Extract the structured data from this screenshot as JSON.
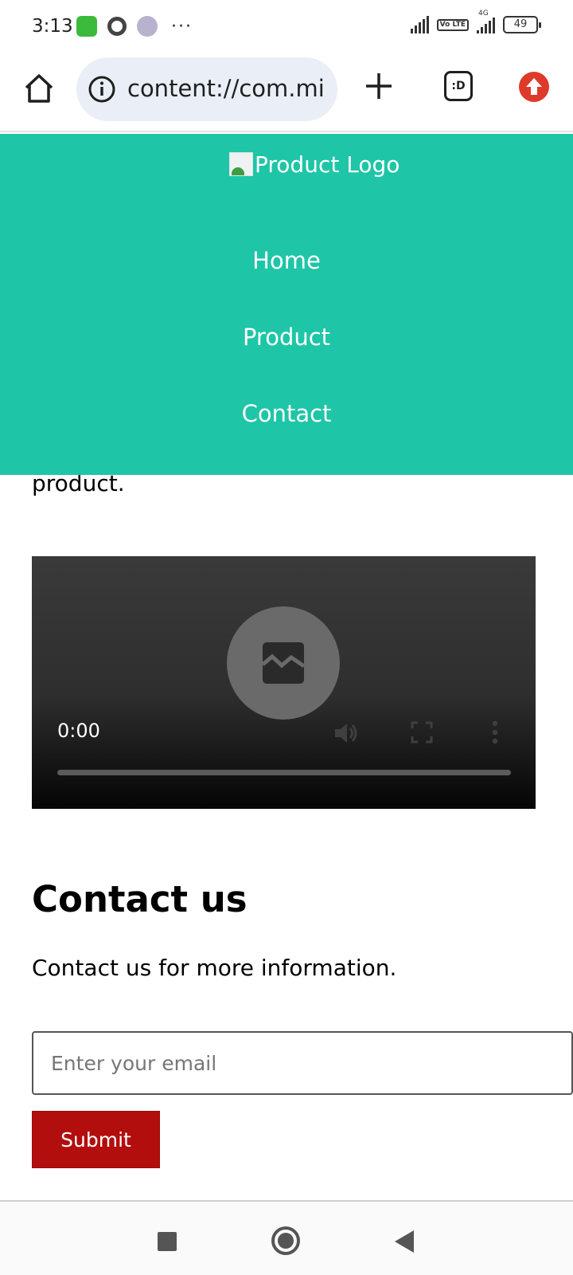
{
  "status_bar": {
    "time": "3:13",
    "network_label": "4G",
    "volte_label": "Vo LTE",
    "battery": "49",
    "overflow": "···"
  },
  "browser": {
    "url": "content://com.mi",
    "tab_switcher_label": ":D",
    "icons": [
      "home-icon",
      "info-icon",
      "plus-icon",
      "tab-switcher-icon",
      "update-icon"
    ]
  },
  "header": {
    "logo_alt": "Product Logo",
    "nav": [
      "Home",
      "Product",
      "Contact"
    ],
    "accent_color": "#1fc5a7"
  },
  "main": {
    "partial_text": "product.",
    "video": {
      "time": "0:00"
    },
    "contact": {
      "heading": "Contact us",
      "text": "Contact us for more information.",
      "email_placeholder": "Enter your email",
      "submit_label": "Submit",
      "submit_color": "#b30e0e"
    }
  }
}
